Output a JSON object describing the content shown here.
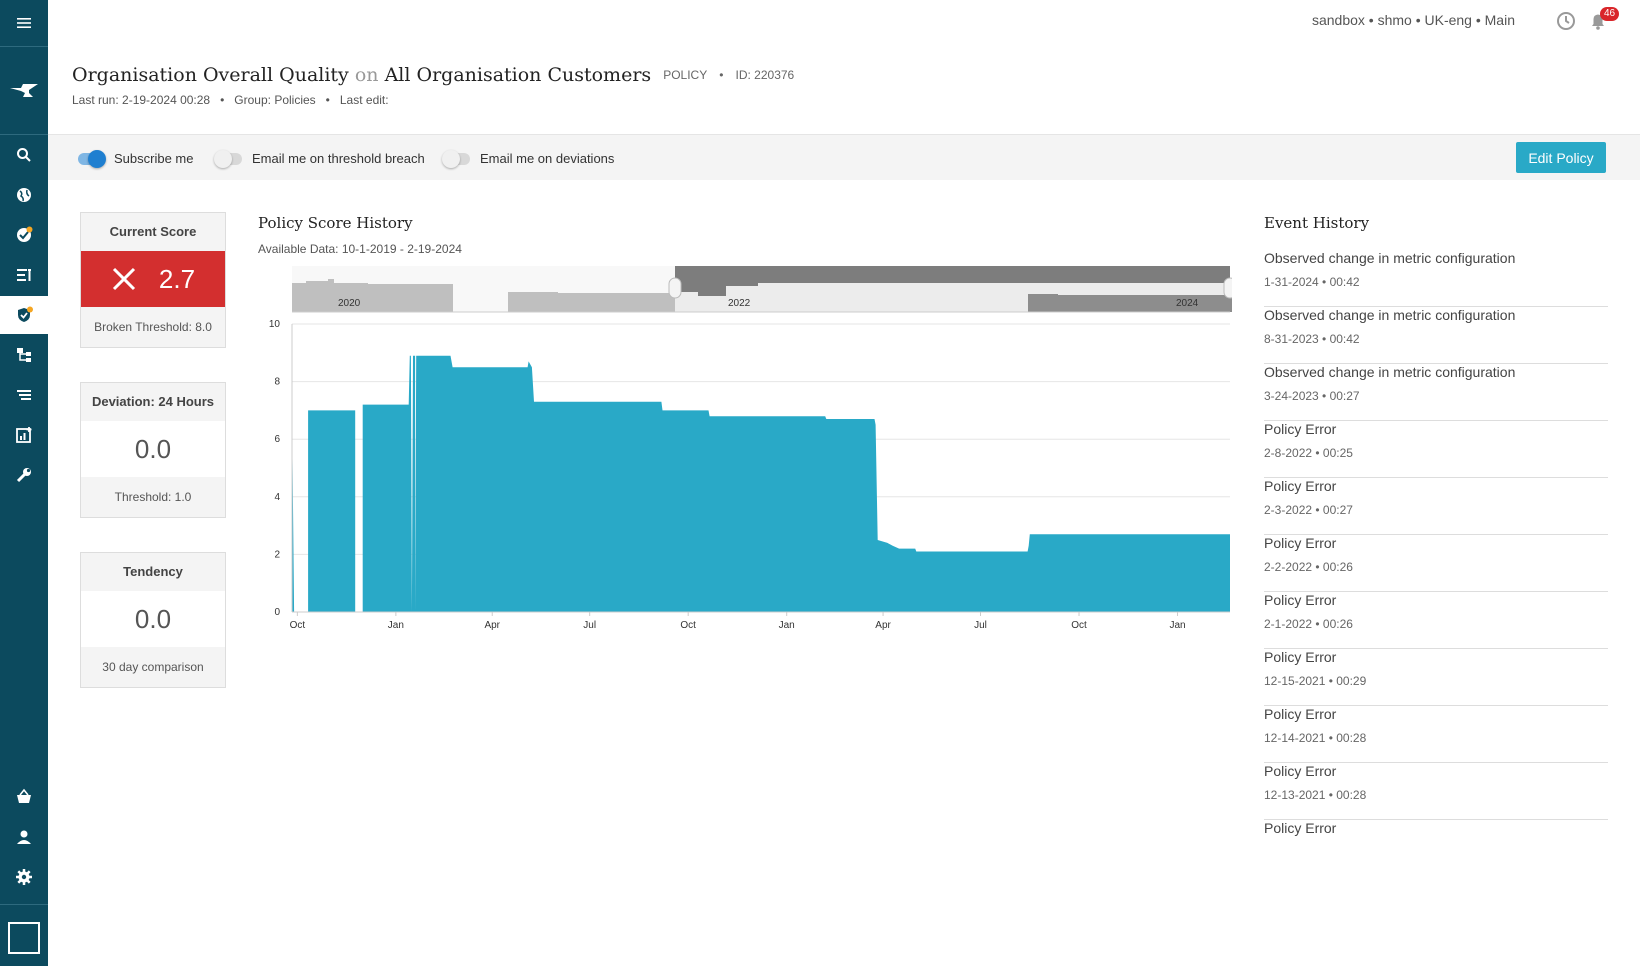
{
  "sidebar": {
    "items": [
      {
        "name": "menu-icon"
      },
      {
        "name": "logo-icon"
      },
      {
        "name": "search-icon"
      },
      {
        "name": "globe-icon"
      },
      {
        "name": "dashboard-icon"
      },
      {
        "name": "list-icon"
      },
      {
        "name": "policy-shield-icon"
      },
      {
        "name": "hierarchy-icon"
      },
      {
        "name": "filter-list-icon"
      },
      {
        "name": "add-chart-icon"
      },
      {
        "name": "wrench-icon"
      },
      {
        "name": "basket-icon"
      },
      {
        "name": "user-icon"
      },
      {
        "name": "settings-icon"
      },
      {
        "name": "square-icon"
      }
    ]
  },
  "topbar": {
    "crumbs": "sandbox • shmo • UK-eng • Main",
    "notification_count": "46"
  },
  "header": {
    "metric": "Organisation Overall Quality",
    "on": "on",
    "target": "All Organisation Customers",
    "type": "POLICY",
    "id": "ID: 220376",
    "subtitle": "Last run: 2-19-2024 00:28   •   Group: Policies   •   Last edit:"
  },
  "toolbar": {
    "subscribe_label": "Subscribe me",
    "subscribe_on": true,
    "threshold_label": "Email me on threshold breach",
    "deviation_label": "Email me on deviations",
    "edit_label": "Edit Policy"
  },
  "cards": {
    "current": {
      "title": "Current Score",
      "value": "2.7",
      "foot": "Broken Threshold: 8.0"
    },
    "deviation": {
      "title": "Deviation: 24 Hours",
      "value": "0.0",
      "foot": "Threshold: 1.0"
    },
    "tendency": {
      "title": "Tendency",
      "value": "0.0",
      "foot": "30 day comparison"
    }
  },
  "chart": {
    "title": "Policy Score History",
    "subtitle": "Available Data: 10-1-2019 - 2-19-2024",
    "navigator_labels": [
      "2020",
      "2022",
      "2024"
    ]
  },
  "chart_data": {
    "type": "area",
    "color": "#29a9c7",
    "ylim": [
      0,
      10
    ],
    "y_ticks": [
      "0",
      "2",
      "4",
      "6",
      "8",
      "10"
    ],
    "x_ticks": [
      "Oct",
      "Jan",
      "Apr",
      "Jul",
      "Oct",
      "Jan",
      "Apr",
      "Jul",
      "Oct",
      "Jan"
    ],
    "x_tick_dates": [
      "2021-10-01",
      "2022-01-01",
      "2022-04-01",
      "2022-07-01",
      "2022-10-01",
      "2023-01-01",
      "2023-04-01",
      "2023-07-01",
      "2023-10-01",
      "2024-01-01"
    ],
    "xlim": [
      "2021-09-26",
      "2024-02-19"
    ],
    "series": [
      {
        "values": [
          {
            "x": "2021-09-26",
            "y": 7.0
          },
          {
            "x": "2021-09-28",
            "y": 0
          },
          {
            "x": "2021-10-11",
            "y": 0
          },
          {
            "x": "2021-10-11",
            "y": 7.0
          },
          {
            "x": "2021-11-24",
            "y": 7.0
          },
          {
            "x": "2021-11-24",
            "y": 0
          },
          {
            "x": "2021-12-01",
            "y": 0
          },
          {
            "x": "2021-12-01",
            "y": 7.2
          },
          {
            "x": "2022-01-13",
            "y": 7.2
          },
          {
            "x": "2022-01-14",
            "y": 8.9
          },
          {
            "x": "2022-01-15",
            "y": 8.9
          },
          {
            "x": "2022-01-16",
            "y": 0
          },
          {
            "x": "2022-01-17",
            "y": 8.9
          },
          {
            "x": "2022-01-19",
            "y": 8.9
          },
          {
            "x": "2022-01-19",
            "y": 0
          },
          {
            "x": "2022-01-20",
            "y": 8.9
          },
          {
            "x": "2022-02-21",
            "y": 8.9
          },
          {
            "x": "2022-02-23",
            "y": 8.5
          },
          {
            "x": "2022-05-04",
            "y": 8.5
          },
          {
            "x": "2022-05-05",
            "y": 8.7
          },
          {
            "x": "2022-05-08",
            "y": 8.5
          },
          {
            "x": "2022-05-10",
            "y": 7.3
          },
          {
            "x": "2022-09-06",
            "y": 7.3
          },
          {
            "x": "2022-09-07",
            "y": 7.0
          },
          {
            "x": "2022-10-20",
            "y": 7.0
          },
          {
            "x": "2022-10-21",
            "y": 6.8
          },
          {
            "x": "2023-02-06",
            "y": 6.8
          },
          {
            "x": "2023-02-07",
            "y": 6.7
          },
          {
            "x": "2023-03-24",
            "y": 6.7
          },
          {
            "x": "2023-03-25",
            "y": 6.5
          },
          {
            "x": "2023-03-27",
            "y": 2.5
          },
          {
            "x": "2023-04-05",
            "y": 2.4
          },
          {
            "x": "2023-04-10",
            "y": 2.3
          },
          {
            "x": "2023-04-16",
            "y": 2.2
          },
          {
            "x": "2023-05-01",
            "y": 2.2
          },
          {
            "x": "2023-05-02",
            "y": 2.1
          },
          {
            "x": "2023-08-14",
            "y": 2.1
          },
          {
            "x": "2023-08-15",
            "y": 2.3
          },
          {
            "x": "2023-08-16",
            "y": 2.7
          },
          {
            "x": "2024-02-19",
            "y": 2.7
          }
        ]
      }
    ]
  },
  "events": {
    "title": "Event History",
    "items": [
      {
        "title": "Observed change in metric configuration",
        "date": "1-31-2024 • 00:42"
      },
      {
        "title": "Observed change in metric configuration",
        "date": "8-31-2023 • 00:42"
      },
      {
        "title": "Observed change in metric configuration",
        "date": "3-24-2023 • 00:27"
      },
      {
        "title": "Policy Error",
        "date": "2-8-2022 • 00:25"
      },
      {
        "title": "Policy Error",
        "date": "2-3-2022 • 00:27"
      },
      {
        "title": "Policy Error",
        "date": "2-2-2022 • 00:26"
      },
      {
        "title": "Policy Error",
        "date": "2-1-2022 • 00:26"
      },
      {
        "title": "Policy Error",
        "date": "12-15-2021 • 00:29"
      },
      {
        "title": "Policy Error",
        "date": "12-14-2021 • 00:28"
      },
      {
        "title": "Policy Error",
        "date": "12-13-2021 • 00:28"
      },
      {
        "title": "Policy Error",
        "date": ""
      }
    ]
  }
}
